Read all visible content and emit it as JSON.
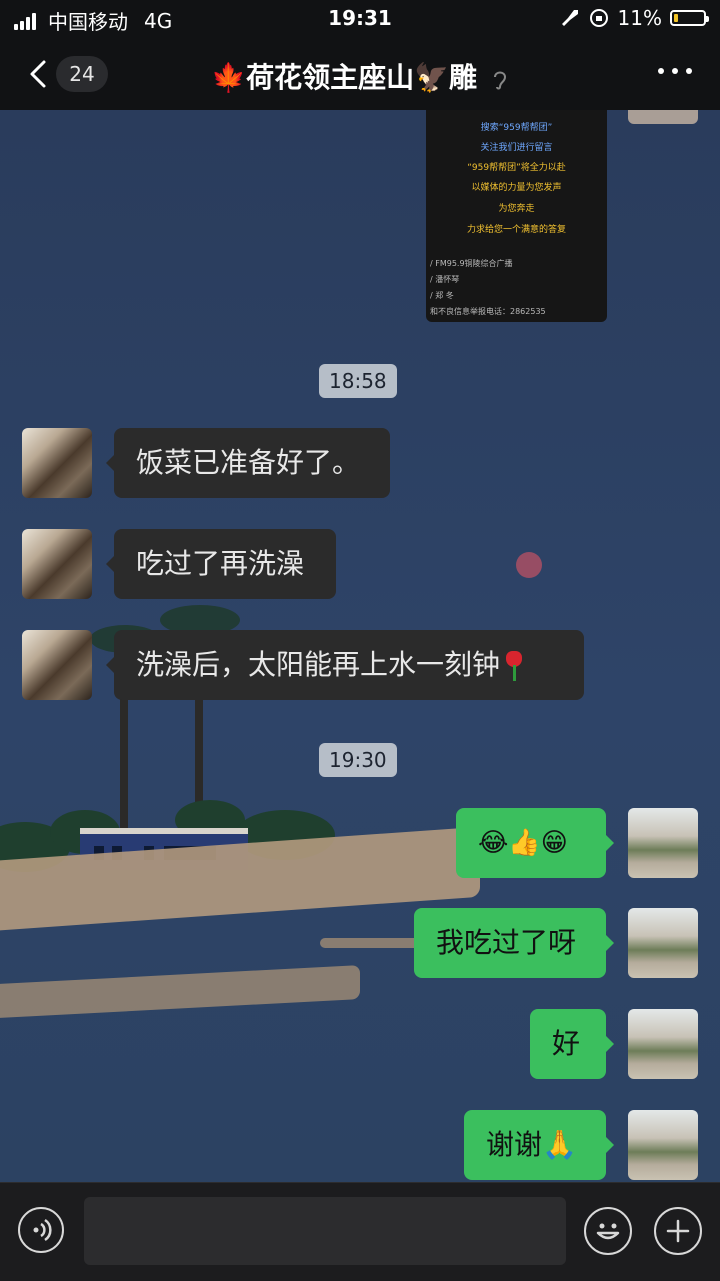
{
  "status_bar": {
    "carrier": "中国移动",
    "network": "4G",
    "time": "19:31",
    "battery": "11%"
  },
  "header": {
    "unread_count": "24",
    "title": "🍁荷花领主座山🦅雕",
    "muted_icon": "ear-icon"
  },
  "poster": {
    "lines": [
      "搜索“959帮帮团”",
      "关注我们进行留言",
      "“959帮帮团”将全力以赴",
      "以媒体的力量为您发声",
      "为您奔走",
      "力求给您一个满意的答复"
    ],
    "credits": [
      "/ FM95.9铜陵综合广播",
      "/ 潘怀琴",
      "/ 郑 冬",
      "和不良信息举报电话：2862535"
    ]
  },
  "messages": [
    {
      "type": "time",
      "text": "18:58"
    },
    {
      "type": "in",
      "text": "饭菜已准备好了。"
    },
    {
      "type": "in",
      "text": "吃过了再洗澡"
    },
    {
      "type": "in",
      "text": "洗澡后，太阳能再上水一刻钟"
    },
    {
      "type": "time",
      "text": "19:30"
    },
    {
      "type": "out",
      "text": "😂👍😁"
    },
    {
      "type": "out",
      "text": "我吃过了呀"
    },
    {
      "type": "out",
      "text": "好"
    },
    {
      "type": "out",
      "text": "谢谢🙏"
    }
  ],
  "colors": {
    "incoming_bubble": "#2b2b2b",
    "outgoing_bubble": "#3bbf5e",
    "timestamp_bg": "#b6bec8",
    "header_bg": "#111214"
  },
  "icons": {
    "back": "chevron-left-icon",
    "more": "more-dots-icon",
    "voice": "voice-icon",
    "emoji": "emoji-icon",
    "plus": "plus-icon"
  }
}
